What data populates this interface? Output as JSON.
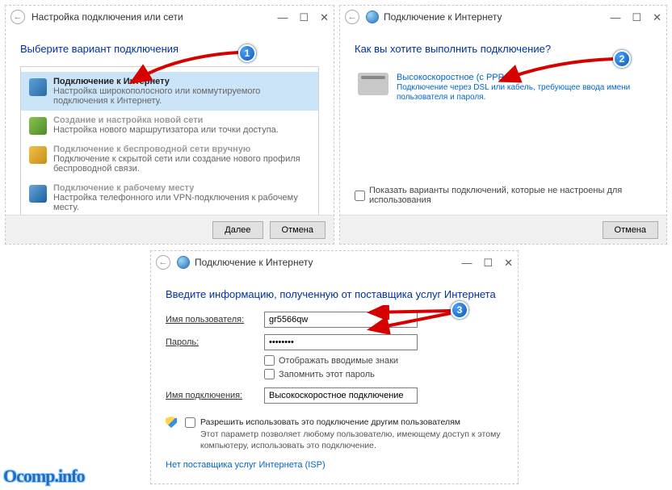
{
  "watermark": "Ocomp.info",
  "win1": {
    "title": "Настройка подключения или сети",
    "heading": "Выберите вариант подключения",
    "options": [
      {
        "title": "Подключение к Интернету",
        "desc": "Настройка широкополосного или коммутируемого подключения к Интернету."
      },
      {
        "title": "Создание и настройка новой сети",
        "desc": "Настройка нового маршрутизатора или точки доступа."
      },
      {
        "title": "Подключение к беспроводной сети вручную",
        "desc": "Подключение к скрытой сети или создание нового профиля беспроводной связи."
      },
      {
        "title": "Подключение к рабочему месту",
        "desc": "Настройка телефонного или VPN-подключения к рабочему месту."
      }
    ],
    "next": "Далее",
    "cancel": "Отмена"
  },
  "win2": {
    "title": "Подключение к Интернету",
    "heading": "Как вы хотите выполнить подключение?",
    "pppoe_title": "Высокоскоростное (с PPPoE)",
    "pppoe_desc": "Подключение через DSL или кабель, требующее ввода имени пользователя и пароля.",
    "show_more": "Показать варианты подключений, которые не настроены для использования",
    "cancel": "Отмена"
  },
  "win3": {
    "title": "Подключение к Интернету",
    "heading": "Введите информацию, полученную от поставщика услуг Интернета",
    "user_label": "Имя пользователя:",
    "user_value": "gr5566qw",
    "pass_label": "Пароль:",
    "pass_value": "••••••••",
    "show_chars": "Отображать вводимые знаки",
    "remember": "Запомнить этот пароль",
    "conn_label": "Имя подключения:",
    "conn_value": "Высокоскоростное подключение",
    "allow_title": "Разрешить использовать это подключение другим пользователям",
    "allow_desc": "Этот параметр позволяет любому пользователю, имеющему доступ к этому компьютеру, использовать это подключение.",
    "no_isp": "Нет поставщика услуг Интернета (ISP)"
  }
}
